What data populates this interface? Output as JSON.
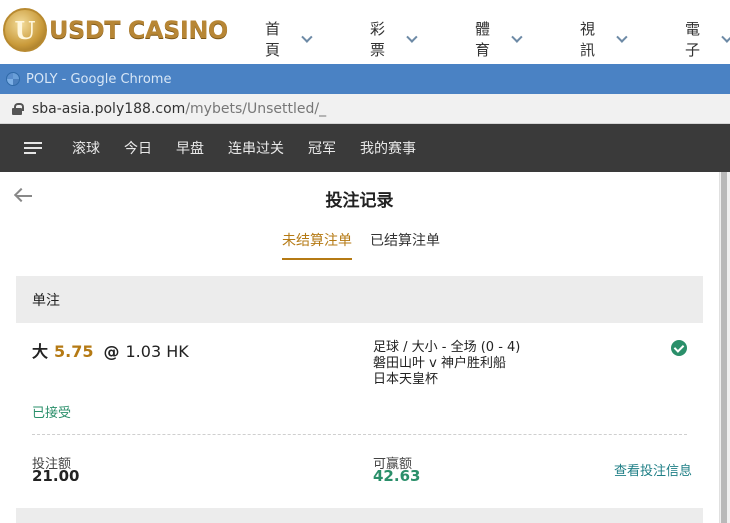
{
  "site": {
    "logo_text": "USDT CASINO",
    "nav": [
      {
        "label": "首頁"
      },
      {
        "label": "彩票"
      },
      {
        "label": "體育"
      },
      {
        "label": "視訊"
      },
      {
        "label": "電子"
      }
    ]
  },
  "browser": {
    "window_title": "POLY - Google Chrome",
    "url_host": "sba-asia.poly188.com",
    "url_path": "/mybets/Unsettled/_"
  },
  "sport_nav": {
    "tabs": [
      {
        "label": "滚球"
      },
      {
        "label": "今日"
      },
      {
        "label": "早盘"
      },
      {
        "label": "连串过关"
      },
      {
        "label": "冠军"
      },
      {
        "label": "我的赛事"
      }
    ]
  },
  "page": {
    "title": "投注记录",
    "tabs": [
      {
        "label": "未结算注单",
        "active": true
      },
      {
        "label": "已结算注单",
        "active": false
      }
    ]
  },
  "bet": {
    "section_title": "单注",
    "selection": "大",
    "handicap": "5.75",
    "at": "@",
    "odds": "1.03 HK",
    "market": "足球 / 大小 - 全场 (0 - 4)",
    "teams": "磐田山叶 v 神户胜利船",
    "league": "日本天皇杯",
    "status": "已接受",
    "stake_label": "投注额",
    "stake_value": "21.00",
    "win_label": "可赢额",
    "win_value": "42.63",
    "details_link": "查看投注信息"
  },
  "colors": {
    "accent": "#b57a14",
    "success": "#2a8f6a",
    "nav_bg": "#3a3a3a",
    "chrome_title_bg": "#4a82c4",
    "link": "#1f7f86"
  }
}
